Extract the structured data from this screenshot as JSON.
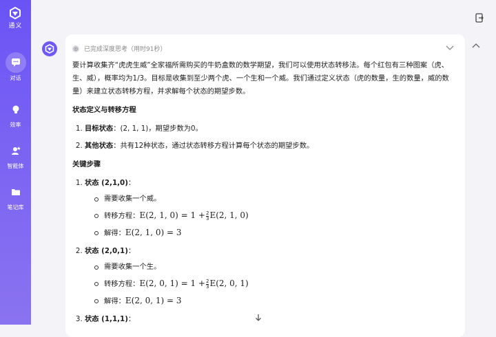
{
  "app": {
    "logo_text": "通义"
  },
  "nav": [
    {
      "label": "对话",
      "icon": "chat-icon"
    },
    {
      "label": "效率",
      "icon": "bulb-icon"
    },
    {
      "label": "智能体",
      "icon": "agent-icon"
    },
    {
      "label": "笔记库",
      "icon": "folder-icon"
    }
  ],
  "thinking": {
    "status": "已完成深度思考（用时91秒）"
  },
  "answer": {
    "intro": "要计算收集齐“虎虎生威”全家福所需购买的牛奶盒数的数学期望，我们可以使用状态转移法。每个红包有三种图案（虎、生、威），概率均为1/3。目标是收集到至少两个虎、一个生和一个威。我们通过定义状态（虎的数量，生的数量，威的数量）来建立状态转移方程，并求解每个状态的期望步数。",
    "section1_title": "状态定义与转移方程",
    "section1_items": [
      {
        "bold": "目标状态",
        "text": "：(2, 1, 1)，期望步数为0。"
      },
      {
        "bold": "其他状态",
        "text": "：共有12种状态，通过状态转移方程计算每个状态的期望步数。"
      }
    ],
    "section2_title": "关键步骤",
    "steps": [
      {
        "title": "状态 (2,1,0)",
        "colon": "：",
        "need": "需要收集一个威。",
        "eq_label": "转移方程：",
        "eq_lhs": "E(2, 1, 0) = 1 +",
        "eq_num": "2",
        "eq_den": "3",
        "eq_rhs": "E(2, 1, 0)",
        "sol_label": "解得：",
        "sol": "E(2, 1, 0) = 3"
      },
      {
        "title": "状态 (2,0,1)",
        "colon": "：",
        "need": "需要收集一个生。",
        "eq_label": "转移方程：",
        "eq_lhs": "E(2, 0, 1) = 1 +",
        "eq_num": "2",
        "eq_den": "3",
        "eq_rhs": "E(2, 0, 1)",
        "sol_label": "解得：",
        "sol": "E(2, 0, 1) = 3"
      },
      {
        "title": "状态 (1,1,1)",
        "colon": "："
      }
    ]
  }
}
